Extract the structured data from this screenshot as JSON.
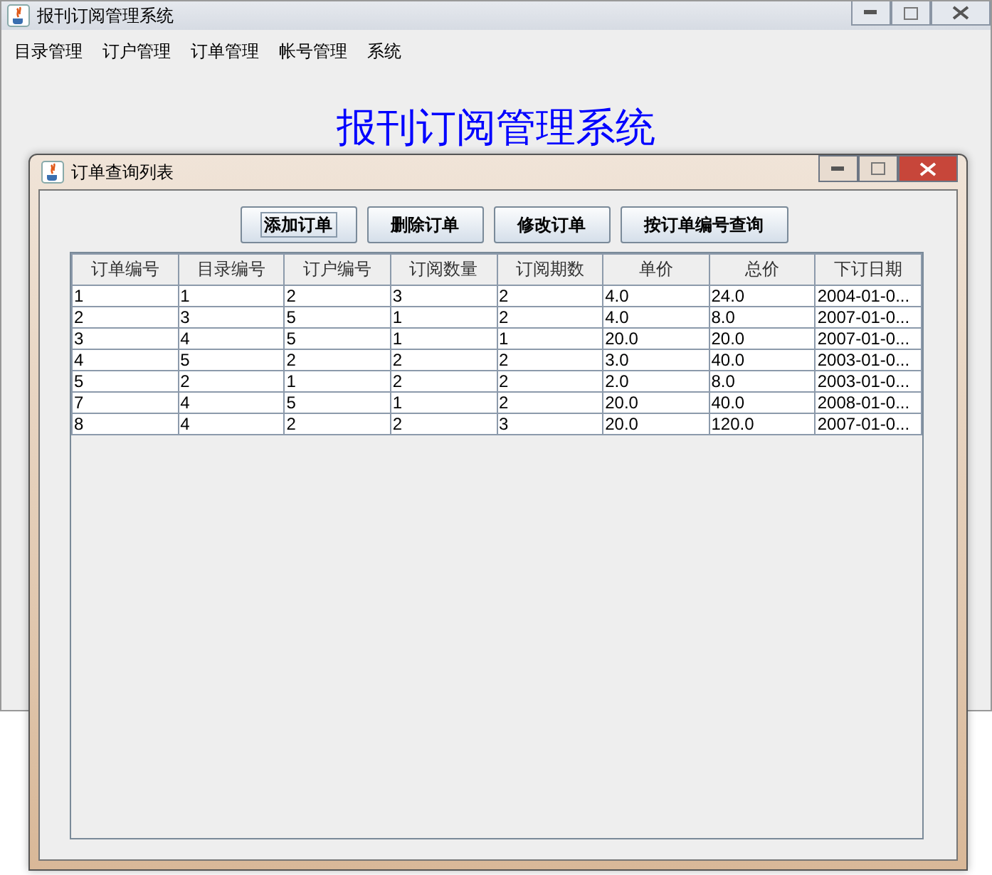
{
  "main_window": {
    "title": "报刊订阅管理系统"
  },
  "menu": [
    {
      "label": "目录管理"
    },
    {
      "label": "订户管理"
    },
    {
      "label": "订单管理"
    },
    {
      "label": "帐号管理"
    },
    {
      "label": "系统"
    }
  ],
  "banner": "报刊订阅管理系统",
  "dialog": {
    "title": "订单查询列表"
  },
  "buttons": [
    {
      "label": "添加订单",
      "focused": true
    },
    {
      "label": "删除订单",
      "focused": false
    },
    {
      "label": "修改订单",
      "focused": false
    },
    {
      "label": "按订单编号查询",
      "focused": false
    }
  ],
  "table": {
    "columns": [
      "订单编号",
      "目录编号",
      "订户编号",
      "订阅数量",
      "订阅期数",
      "单价",
      "总价",
      "下订日期"
    ],
    "rows": [
      [
        "1",
        "1",
        "2",
        "3",
        "2",
        "4.0",
        "24.0",
        "2004-01-0..."
      ],
      [
        "2",
        "3",
        "5",
        "1",
        "2",
        "4.0",
        "8.0",
        "2007-01-0..."
      ],
      [
        "3",
        "4",
        "5",
        "1",
        "1",
        "20.0",
        "20.0",
        "2007-01-0..."
      ],
      [
        "4",
        "5",
        "2",
        "2",
        "2",
        "3.0",
        "40.0",
        "2003-01-0..."
      ],
      [
        "5",
        "2",
        "1",
        "2",
        "2",
        "2.0",
        "8.0",
        "2003-01-0..."
      ],
      [
        "7",
        "4",
        "5",
        "1",
        "2",
        "20.0",
        "40.0",
        "2008-01-0..."
      ],
      [
        "8",
        "4",
        "2",
        "2",
        "3",
        "20.0",
        "120.0",
        "2007-01-0..."
      ]
    ]
  }
}
